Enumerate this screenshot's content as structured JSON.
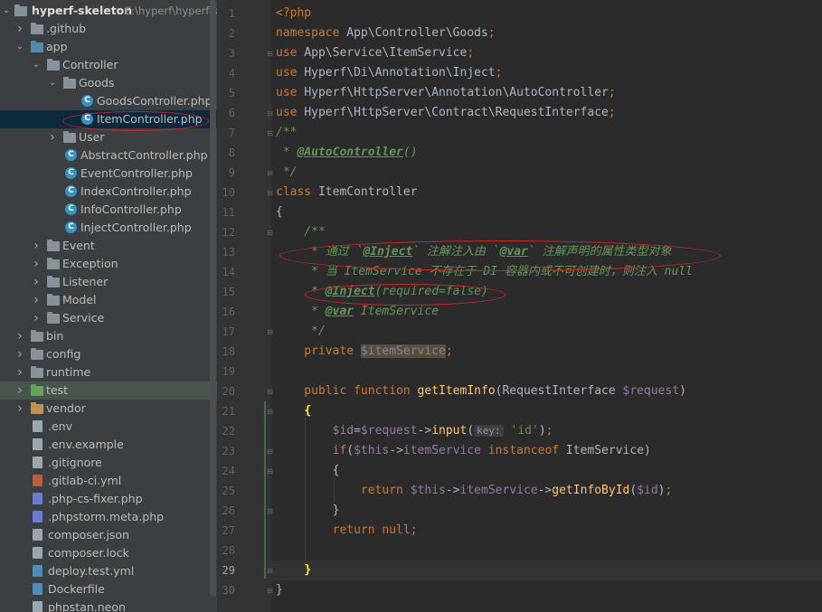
{
  "project": {
    "name": "hyperf-skeleton",
    "path": "E:\\hyperf\\hyperf-s"
  },
  "tree": [
    {
      "label": ".github",
      "icon": "folder-icon",
      "depth": 1,
      "arrow": "right"
    },
    {
      "label": "app",
      "icon": "folder-icon",
      "depth": 1,
      "arrow": "down",
      "color": "blue"
    },
    {
      "label": "Controller",
      "icon": "folder-icon",
      "depth": 2,
      "arrow": "down"
    },
    {
      "label": "Goods",
      "icon": "folder-icon",
      "depth": 3,
      "arrow": "down"
    },
    {
      "label": "GoodsController.php",
      "icon": "php-class-icon",
      "depth": 4
    },
    {
      "label": "ItemController.php",
      "icon": "php-class-icon",
      "depth": 4,
      "selected": true
    },
    {
      "label": "User",
      "icon": "folder-icon",
      "depth": 3,
      "arrow": "right"
    },
    {
      "label": "AbstractController.php",
      "icon": "abstract-class-icon",
      "depth": 3
    },
    {
      "label": "EventController.php",
      "icon": "php-class-icon",
      "depth": 3
    },
    {
      "label": "IndexController.php",
      "icon": "php-class-icon",
      "depth": 3
    },
    {
      "label": "InfoController.php",
      "icon": "php-class-icon",
      "depth": 3
    },
    {
      "label": "InjectController.php",
      "icon": "php-class-icon",
      "depth": 3
    },
    {
      "label": "Event",
      "icon": "folder-icon",
      "depth": 2,
      "arrow": "right"
    },
    {
      "label": "Exception",
      "icon": "folder-icon",
      "depth": 2,
      "arrow": "right"
    },
    {
      "label": "Listener",
      "icon": "folder-icon",
      "depth": 2,
      "arrow": "right"
    },
    {
      "label": "Model",
      "icon": "folder-icon",
      "depth": 2,
      "arrow": "right"
    },
    {
      "label": "Service",
      "icon": "folder-icon",
      "depth": 2,
      "arrow": "right"
    },
    {
      "label": "bin",
      "icon": "folder-icon",
      "depth": 1,
      "arrow": "right"
    },
    {
      "label": "config",
      "icon": "folder-icon",
      "depth": 1,
      "arrow": "right"
    },
    {
      "label": "runtime",
      "icon": "folder-icon",
      "depth": 1,
      "arrow": "right"
    },
    {
      "label": "test",
      "icon": "folder-icon",
      "depth": 1,
      "arrow": "right",
      "color": "green",
      "highlight": true
    },
    {
      "label": "vendor",
      "icon": "folder-icon",
      "depth": 1,
      "arrow": "right",
      "color": "orange"
    },
    {
      "label": ".env",
      "icon": "file-icon",
      "depth": 1
    },
    {
      "label": ".env.example",
      "icon": "file-icon",
      "depth": 1
    },
    {
      "label": ".gitignore",
      "icon": "file-icon",
      "depth": 1
    },
    {
      "label": ".gitlab-ci.yml",
      "icon": "yml-file-icon",
      "depth": 1
    },
    {
      "label": ".php-cs-fixer.php",
      "icon": "php-file-icon",
      "depth": 1
    },
    {
      "label": ".phpstorm.meta.php",
      "icon": "php-file-icon",
      "depth": 1
    },
    {
      "label": "composer.json",
      "icon": "json-file-icon",
      "depth": 1
    },
    {
      "label": "composer.lock",
      "icon": "json-file-icon",
      "depth": 1
    },
    {
      "label": "deploy.test.yml",
      "icon": "doc-file-icon",
      "depth": 1
    },
    {
      "label": "Dockerfile",
      "icon": "doc-file-icon",
      "depth": 1
    },
    {
      "label": "phpstan.neon",
      "icon": "file-icon",
      "depth": 1
    }
  ],
  "editor": {
    "current_line": 29,
    "lines": [
      {
        "n": "1",
        "tokens": [
          [
            "kw",
            "<?php"
          ]
        ]
      },
      {
        "n": "2",
        "tokens": [
          [
            "kw",
            "namespace "
          ],
          [
            "ns",
            "App\\Controller\\Goods"
          ],
          [
            "kw",
            ";"
          ]
        ]
      },
      {
        "n": "3",
        "tokens": [
          [
            "kw",
            "use "
          ],
          [
            "ns",
            "App\\Service\\ItemService"
          ],
          [
            "kw",
            ";"
          ]
        ]
      },
      {
        "n": "4",
        "tokens": [
          [
            "kw",
            "use "
          ],
          [
            "ns",
            "Hyperf\\Di\\Annotation\\Inject"
          ],
          [
            "kw",
            ";"
          ]
        ]
      },
      {
        "n": "5",
        "tokens": [
          [
            "kw",
            "use "
          ],
          [
            "ns",
            "Hyperf\\HttpServer\\Annotation\\AutoController"
          ],
          [
            "kw",
            ";"
          ]
        ]
      },
      {
        "n": "6",
        "tokens": [
          [
            "kw",
            "use "
          ],
          [
            "ns",
            "Hyperf\\HttpServer\\Contract\\RequestInterface"
          ],
          [
            "kw",
            ";"
          ]
        ]
      },
      {
        "n": "7",
        "tokens": [
          [
            "cm",
            "/**"
          ]
        ]
      },
      {
        "n": "8",
        "tokens": [
          [
            "cm",
            " * "
          ],
          [
            "tag",
            "@AutoController"
          ],
          [
            "cm",
            "()"
          ]
        ]
      },
      {
        "n": "9",
        "tokens": [
          [
            "cm",
            " */"
          ]
        ]
      },
      {
        "n": "10",
        "tokens": [
          [
            "kw",
            "class "
          ],
          [
            "ns",
            "ItemController"
          ]
        ]
      },
      {
        "n": "11",
        "tokens": [
          [
            "ns",
            "{"
          ]
        ]
      },
      {
        "n": "12",
        "tokens": [
          [
            "cm",
            "    /**"
          ]
        ]
      },
      {
        "n": "13",
        "tokens": [
          [
            "cm",
            "     * 通过 `"
          ],
          [
            "tag",
            "@Inject"
          ],
          [
            "cm",
            "` 注解注入由 `"
          ],
          [
            "tag",
            "@var"
          ],
          [
            "cm",
            "` 注解声明的属性类型对象"
          ]
        ]
      },
      {
        "n": "14",
        "tokens": [
          [
            "cm",
            "     * 当 ItemService 不存在于 DI 容器内或不可创建时，则注入 null"
          ]
        ]
      },
      {
        "n": "15",
        "tokens": [
          [
            "cm",
            "     * "
          ],
          [
            "tag",
            "@Inject"
          ],
          [
            "cm",
            "(required=false)"
          ]
        ]
      },
      {
        "n": "16",
        "tokens": [
          [
            "cm",
            "     * "
          ],
          [
            "tag",
            "@var"
          ],
          [
            "cm",
            " ItemService"
          ]
        ]
      },
      {
        "n": "17",
        "tokens": [
          [
            "cm",
            "     */"
          ]
        ]
      },
      {
        "n": "18",
        "tokens": [
          [
            "kw",
            "    private "
          ],
          [
            "ivar",
            "$itemService"
          ],
          [
            "kw",
            ";"
          ]
        ]
      },
      {
        "n": "19",
        "tokens": []
      },
      {
        "n": "20",
        "tokens": [
          [
            "kw",
            "    public function "
          ],
          [
            "fn",
            "getItemInfo"
          ],
          [
            "ns",
            "(RequestInterface "
          ],
          [
            "var",
            "$request"
          ],
          [
            "ns",
            ")"
          ]
        ]
      },
      {
        "n": "21",
        "tokens": [
          [
            "ns",
            "    "
          ],
          [
            "brace",
            "{"
          ]
        ]
      },
      {
        "n": "22",
        "tokens": [
          [
            "var",
            "        $id"
          ],
          [
            "ns",
            "="
          ],
          [
            "var",
            "$request"
          ],
          [
            "ns",
            "->"
          ],
          [
            "fn",
            "input"
          ],
          [
            "ns",
            "("
          ],
          [
            "hint",
            "key:"
          ],
          [
            "str",
            " 'id'"
          ],
          [
            "ns",
            ")"
          ],
          [
            "kw",
            ";"
          ]
        ]
      },
      {
        "n": "23",
        "tokens": [
          [
            "kw",
            "        if"
          ],
          [
            "ns",
            "("
          ],
          [
            "var",
            "$this"
          ],
          [
            "ns",
            "->"
          ],
          [
            "var",
            "itemService "
          ],
          [
            "kw",
            "instanceof "
          ],
          [
            "ns",
            "ItemService)"
          ]
        ]
      },
      {
        "n": "24",
        "tokens": [
          [
            "ns",
            "        {"
          ]
        ]
      },
      {
        "n": "25",
        "tokens": [
          [
            "kw",
            "            return "
          ],
          [
            "var",
            "$this"
          ],
          [
            "ns",
            "->"
          ],
          [
            "var",
            "itemService"
          ],
          [
            "ns",
            "->"
          ],
          [
            "fn",
            "getInfoById"
          ],
          [
            "ns",
            "("
          ],
          [
            "var",
            "$id"
          ],
          [
            "ns",
            ")"
          ],
          [
            "kw",
            ";"
          ]
        ]
      },
      {
        "n": "26",
        "tokens": [
          [
            "ns",
            "        }"
          ]
        ]
      },
      {
        "n": "27",
        "tokens": [
          [
            "kw",
            "        return null;"
          ]
        ]
      },
      {
        "n": "28",
        "tokens": []
      },
      {
        "n": "29",
        "tokens": [
          [
            "ns",
            "    "
          ],
          [
            "brace",
            "}"
          ]
        ]
      },
      {
        "n": "30",
        "tokens": [
          [
            "ns",
            "}"
          ]
        ]
      }
    ]
  },
  "colors": {
    "tree_bg": "#3c3f41",
    "editor_bg": "#2b2b2b",
    "keyword": "#cc7832",
    "comment": "#629755",
    "annotation_circle": "#dd2222"
  }
}
